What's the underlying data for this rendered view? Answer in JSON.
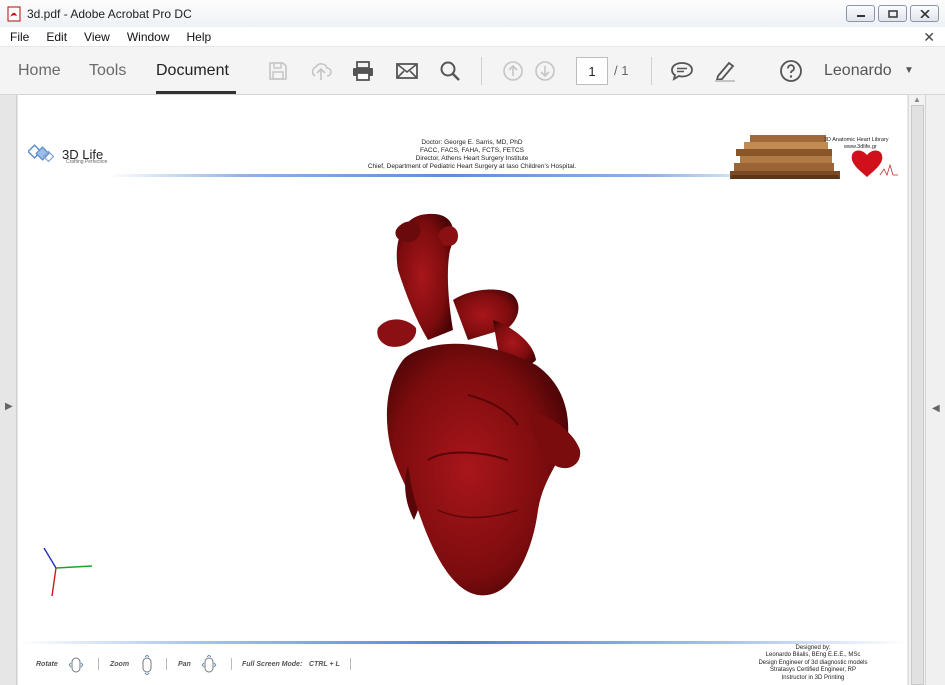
{
  "window": {
    "title": "3d.pdf - Adobe Acrobat Pro DC"
  },
  "menu": [
    "File",
    "Edit",
    "View",
    "Window",
    "Help"
  ],
  "toolbar": {
    "tabs": [
      "Home",
      "Tools",
      "Document"
    ],
    "active_tab": "Document",
    "icons": [
      "save-icon",
      "upload-icon",
      "print-icon",
      "email-icon",
      "search-icon",
      "page-up-icon",
      "page-down-icon",
      "comment-icon",
      "highlight-pen-icon",
      "help-icon"
    ],
    "page_current": "1",
    "page_total": "/ 1",
    "user": "Leonardo"
  },
  "document": {
    "logo_name": "3D Life",
    "logo_tagline": "Crafting Perfection",
    "doctor_lines": [
      "Doctor: George E. Sarris, MD, PhD",
      "FACC, FACS, FAHA, FCTS, FETCS",
      "Director, Athens Heart Surgery Institute",
      "Chief, Department of Pediatric Heart Surgery at Iaso Children's Hospital."
    ],
    "library_title": "3D Anatomic Heart Library",
    "library_url": "www.3dlife.gr",
    "controls": {
      "rotate": "Rotate",
      "zoom": "Zoom",
      "pan": "Pan",
      "fullscreen": "Full Screen Mode:",
      "fullscreen_key": "CTRL + L"
    },
    "designer_lines": [
      "Designed by:",
      "Leonardo Bilalis, BEng E.E.E., MSc",
      "Design Engineer of 3d diagnostic models",
      "Stratasys Certified Engineer, RP",
      "Instructor in 3D Printing"
    ]
  },
  "colors": {
    "heart": "#8b0f0f",
    "accent_rule": "#5c8fd9"
  }
}
